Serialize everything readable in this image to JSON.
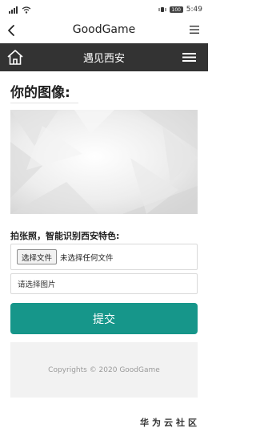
{
  "status_bar": {
    "time": "5:49",
    "battery": "100"
  },
  "header": {
    "title": "GoodGame"
  },
  "nav": {
    "title": "遇见西安"
  },
  "main": {
    "heading": "你的图像:",
    "upload_label": "拍张照，智能识别西安特色:",
    "file_button_label": "选择文件",
    "file_status": "未选择任何文件",
    "select_placeholder": "请选择图片",
    "submit_label": "提交"
  },
  "footer": {
    "copyright": "Copyrights © 2020 GoodGame"
  },
  "watermark": {
    "text": "华为云社区"
  },
  "colors": {
    "nav_bg": "#333333",
    "accent": "#16968a",
    "footer_bg": "#f2f2f2"
  },
  "icons": [
    "signal-icon",
    "wifi-icon",
    "back-arrow-icon",
    "menu-icon",
    "home-icon",
    "hamburger-icon"
  ]
}
